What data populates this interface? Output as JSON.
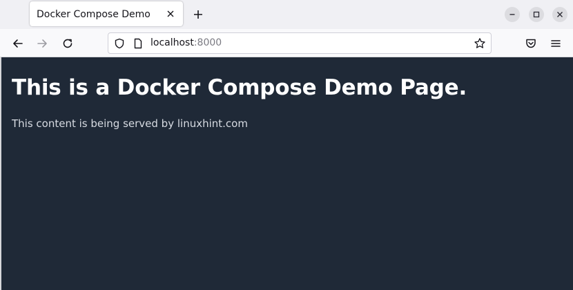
{
  "tab": {
    "title": "Docker Compose Demo"
  },
  "address_bar": {
    "host": "localhost",
    "port": ":8000"
  },
  "page": {
    "heading": "This is a Docker Compose Demo Page.",
    "paragraph": "This content is being served by linuxhint.com"
  },
  "colors": {
    "page_background": "#1f2937",
    "heading_text": "#ffffff",
    "body_text": "#d7dbe2"
  },
  "icons": {
    "tab_close": "close-icon",
    "new_tab": "plus-icon",
    "minimize": "minimize-icon",
    "maximize": "maximize-icon",
    "window_close": "close-icon",
    "back": "arrow-left-icon",
    "forward": "arrow-right-icon",
    "reload": "reload-icon",
    "tracking_protection": "shield-icon",
    "page_info": "page-icon",
    "bookmark": "star-icon",
    "pocket": "pocket-icon",
    "menu": "hamburger-menu-icon"
  }
}
